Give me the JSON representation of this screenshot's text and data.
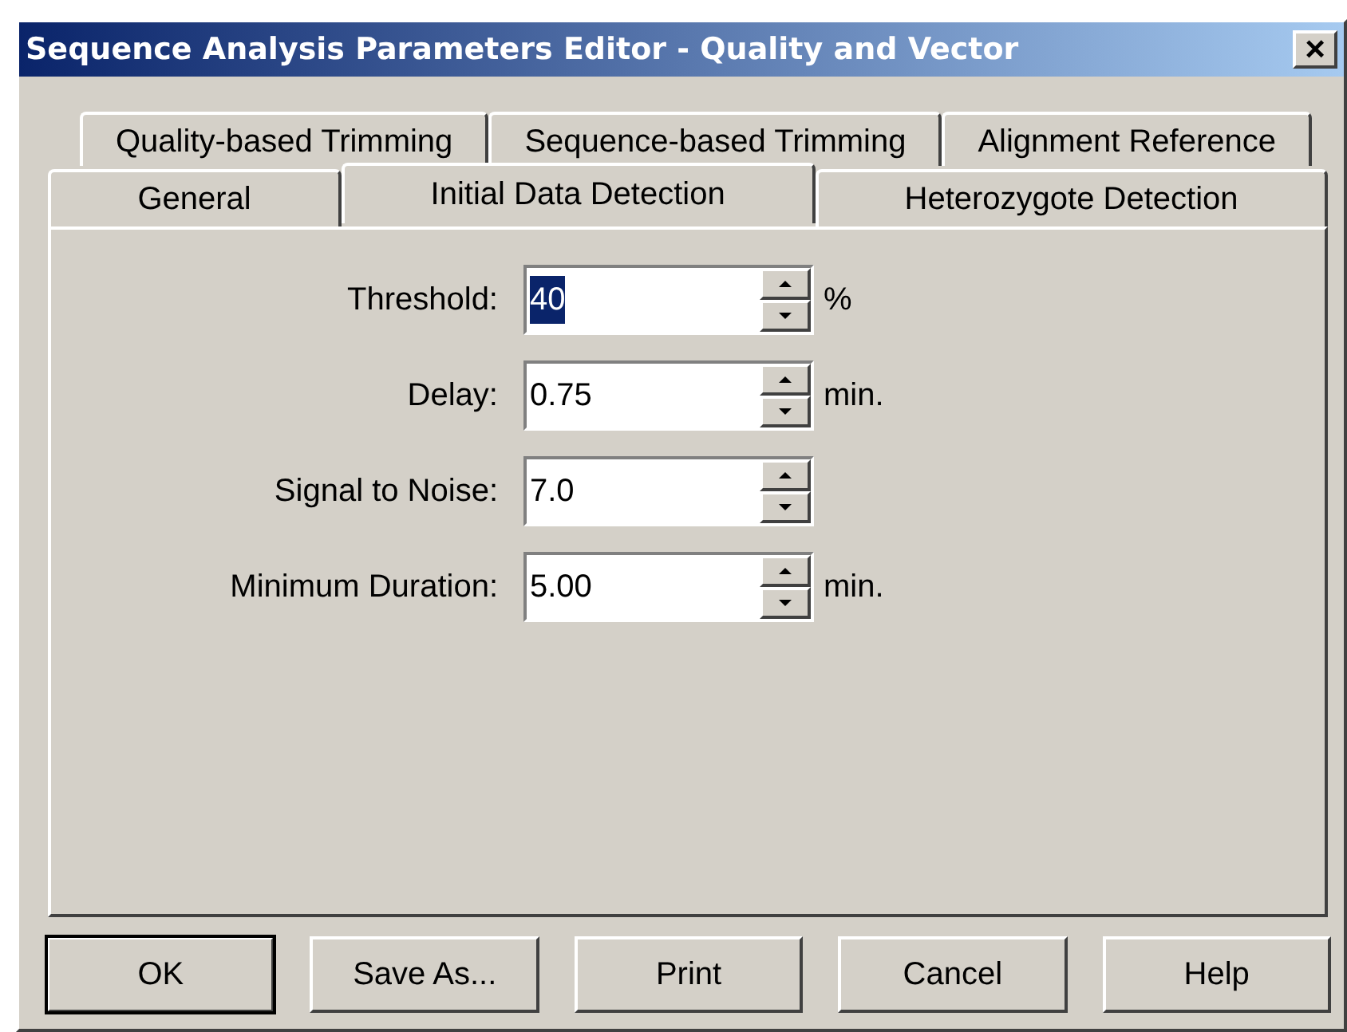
{
  "window": {
    "title": "Sequence Analysis Parameters Editor - Quality and Vector",
    "close": "×"
  },
  "tab_rows": [
    {
      "tabs": [
        {
          "label": "Quality-based Trimming",
          "selected": false
        },
        {
          "label": "Sequence-based Trimming",
          "selected": false
        },
        {
          "label": "Alignment Reference",
          "selected": false
        }
      ]
    },
    {
      "tabs": [
        {
          "label": "General",
          "selected": false
        },
        {
          "label": "Initial Data Detection",
          "selected": true
        },
        {
          "label": "Heterozygote Detection",
          "selected": false
        }
      ]
    }
  ],
  "fields": [
    {
      "label": "Threshold:",
      "value": "40",
      "unit": "%",
      "text_selected": true
    },
    {
      "label": "Delay:",
      "value": "0.75",
      "unit": "min.",
      "text_selected": false
    },
    {
      "label": "Signal to Noise:",
      "value": "7.0",
      "text_selected": false
    },
    {
      "label": "Minimum Duration:",
      "value": "5.00",
      "unit": "min.",
      "text_selected": false
    }
  ],
  "buttons": [
    {
      "label": "OK",
      "default": true
    },
    {
      "label": "Save As...",
      "default": false
    },
    {
      "label": "Print",
      "default": false
    },
    {
      "label": "Cancel",
      "default": false
    },
    {
      "label": "Help",
      "default": false
    }
  ]
}
